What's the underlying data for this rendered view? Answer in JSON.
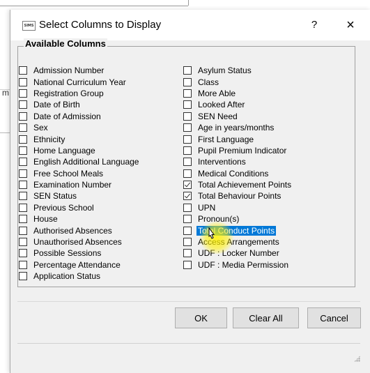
{
  "dialog": {
    "title": "Select Columns to Display",
    "app_icon_label": "SIMS",
    "help_label": "?",
    "close_label": "×"
  },
  "background": {
    "fragment": "m"
  },
  "group": {
    "title": "Available Columns"
  },
  "columns_left": [
    {
      "label": "Admission Number",
      "checked": false
    },
    {
      "label": "National Curriculum Year",
      "checked": false
    },
    {
      "label": "Registration Group",
      "checked": false
    },
    {
      "label": "Date of Birth",
      "checked": false
    },
    {
      "label": "Date of Admission",
      "checked": false
    },
    {
      "label": "Sex",
      "checked": false
    },
    {
      "label": "Ethnicity",
      "checked": false
    },
    {
      "label": "Home Language",
      "checked": false
    },
    {
      "label": "English Additional Language",
      "checked": false
    },
    {
      "label": "Free School Meals",
      "checked": false
    },
    {
      "label": "Examination Number",
      "checked": false
    },
    {
      "label": "SEN Status",
      "checked": false
    },
    {
      "label": "Previous School",
      "checked": false
    },
    {
      "label": "House",
      "checked": false
    },
    {
      "label": "Authorised Absences",
      "checked": false
    },
    {
      "label": "Unauthorised Absences",
      "checked": false
    },
    {
      "label": "Possible Sessions",
      "checked": false
    },
    {
      "label": "Percentage Attendance",
      "checked": false
    },
    {
      "label": "Application Status",
      "checked": false
    }
  ],
  "columns_right": [
    {
      "label": "Asylum Status",
      "checked": false
    },
    {
      "label": "Class",
      "checked": false
    },
    {
      "label": "More Able",
      "checked": false
    },
    {
      "label": "Looked After",
      "checked": false
    },
    {
      "label": "SEN Need",
      "checked": false
    },
    {
      "label": "Age in years/months",
      "checked": false
    },
    {
      "label": "First Language",
      "checked": false
    },
    {
      "label": "Pupil Premium Indicator",
      "checked": false
    },
    {
      "label": "Interventions",
      "checked": false
    },
    {
      "label": "Medical Conditions",
      "checked": false
    },
    {
      "label": "Total Achievement Points",
      "checked": true
    },
    {
      "label": "Total Behaviour Points",
      "checked": true
    },
    {
      "label": "UPN",
      "checked": false
    },
    {
      "label": "Pronoun(s)",
      "checked": false
    },
    {
      "label": "Total Conduct Points",
      "checked": false,
      "selected": true
    },
    {
      "label": "Access Arrangements",
      "checked": false
    },
    {
      "label": "UDF : Locker Number",
      "checked": false
    },
    {
      "label": "UDF : Media Permission",
      "checked": false
    }
  ],
  "buttons": {
    "ok": "OK",
    "clear_all": "Clear All",
    "cancel": "Cancel"
  },
  "colors": {
    "selection": "#0078d7",
    "cursor_highlight": "#fff200",
    "dialog_bg": "#f0f0f0"
  }
}
